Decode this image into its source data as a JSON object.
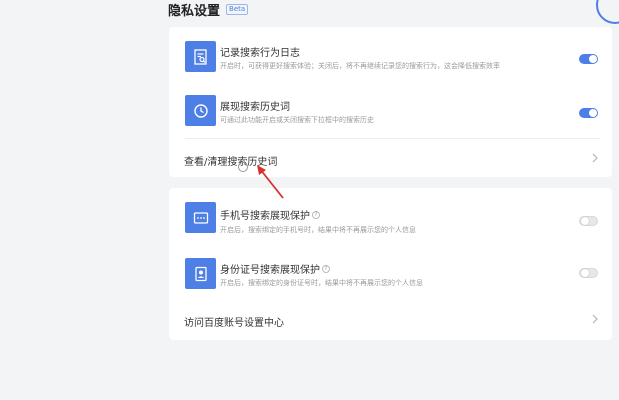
{
  "page": {
    "title": "隐私设置",
    "badge": "Beta"
  },
  "card1": {
    "rows": [
      {
        "label": "记录搜索行为日志",
        "desc": "开启时，可获得更好搜索体验；关闭后，将不再继续记录您的搜索行为，这会降低搜索效率",
        "toggle": "on",
        "icon": "document-search-icon"
      },
      {
        "label": "展现搜索历史词",
        "desc": "可通过此功能开启或关闭搜索下拉框中的搜索历史",
        "toggle": "on",
        "icon": "clock-icon"
      }
    ],
    "link": "查看/清理搜索历史词"
  },
  "card2": {
    "rows": [
      {
        "label": "手机号搜索展现保护",
        "desc": "开启后，搜索绑定的手机号时，结果中将不再展示您的个人信息",
        "toggle": "off",
        "icon": "phone-icon"
      },
      {
        "label": "身份证号搜索展现保护",
        "desc": "开启后，搜索绑定的身份证号时，结果中将不再展示您的个人信息",
        "toggle": "off",
        "icon": "id-card-icon"
      }
    ],
    "link": "访问百度账号设置中心"
  },
  "colors": {
    "accent": "#4e7fe6",
    "arrow": "#d9302c",
    "background": "#f3f4f6"
  }
}
